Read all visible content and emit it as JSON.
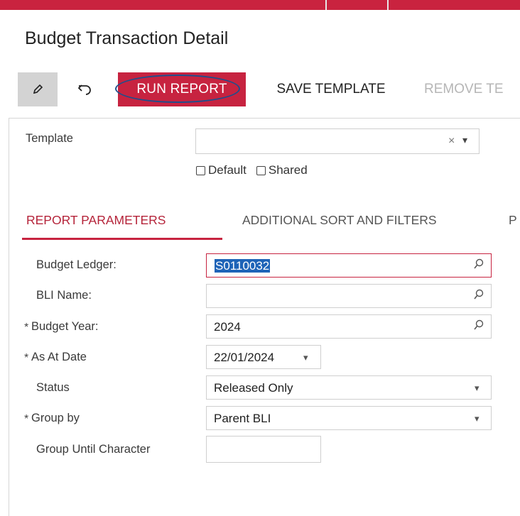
{
  "page": {
    "title": "Budget Transaction Detail"
  },
  "toolbar": {
    "run_report": "RUN REPORT",
    "save_template": "SAVE TEMPLATE",
    "remove_template": "REMOVE TE"
  },
  "template": {
    "label": "Template",
    "value": "",
    "default_label": "Default",
    "shared_label": "Shared",
    "clear_symbol": "×",
    "dropdown_symbol": "▾"
  },
  "tabs": [
    {
      "label": "REPORT PARAMETERS"
    },
    {
      "label": "ADDITIONAL SORT AND FILTERS"
    },
    {
      "label": "P"
    }
  ],
  "form": {
    "budget_ledger": {
      "label": "Budget Ledger:",
      "value": "S0110032"
    },
    "bli_name": {
      "label": "BLI Name:",
      "value": ""
    },
    "budget_year": {
      "label": "Budget Year:",
      "value": "2024"
    },
    "as_at_date": {
      "label": "As At Date",
      "value": "22/01/2024"
    },
    "status": {
      "label": "Status",
      "value": "Released Only"
    },
    "group_by": {
      "label": "Group by",
      "value": "Parent BLI"
    },
    "group_until_character": {
      "label": "Group Until Character",
      "value": ""
    },
    "required_marker": "*"
  },
  "colors": {
    "accent": "#c72340",
    "selection": "#1e63b7",
    "outline": "#1f4e8c"
  }
}
